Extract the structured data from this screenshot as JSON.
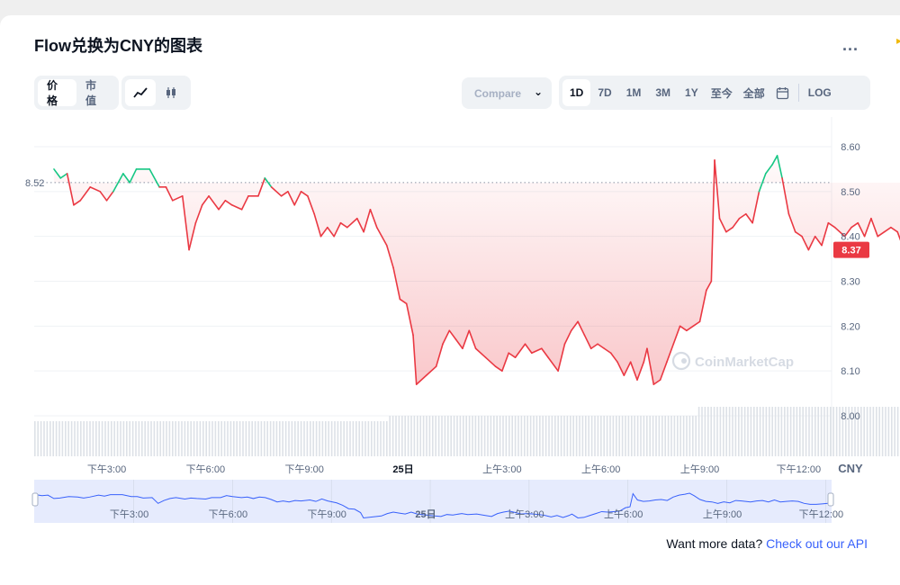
{
  "header": {
    "title": "Flow兑换为CNY的图表",
    "more_label": "...",
    "left_tabs": [
      "价格",
      "市值"
    ],
    "compare_label": "Compare",
    "ranges": [
      "1D",
      "7D",
      "1M",
      "3M",
      "1Y",
      "至今",
      "全部"
    ],
    "log_label": "LOG"
  },
  "footer": {
    "prefix": "Want more data?",
    "link": "Check out our API"
  },
  "watermark": "CoinMarketCap",
  "colors": {
    "up": "#16c784",
    "down": "#ea3943",
    "accent": "#3861fb",
    "nav_fill": "#e6ebfd"
  },
  "chart_data": {
    "type": "line",
    "y_axis_unit": "CNY",
    "ylim": [
      7.9,
      8.62
    ],
    "y_ticks": [
      8.0,
      8.1,
      8.2,
      8.3,
      8.4,
      8.5,
      8.6
    ],
    "y_tick_labels": [
      "8.00",
      "8.10",
      "8.20",
      "8.30",
      "8.40",
      "8.50",
      "8.60"
    ],
    "x_range_hours": [
      12.8,
      37.0
    ],
    "x_ticks": [
      {
        "h": 15,
        "label": "下午3:00"
      },
      {
        "h": 18,
        "label": "下午6:00"
      },
      {
        "h": 21,
        "label": "下午9:00"
      },
      {
        "h": 24,
        "label": "25日"
      },
      {
        "h": 27,
        "label": "上午3:00"
      },
      {
        "h": 30,
        "label": "上午6:00"
      },
      {
        "h": 33,
        "label": "上午9:00"
      },
      {
        "h": 36,
        "label": "下午12:00"
      }
    ],
    "reference_price": 8.52,
    "reference_label": "8.52",
    "last_price": 8.37,
    "last_label": "8.37",
    "series": [
      {
        "values": [
          [
            13.4,
            8.55
          ],
          [
            13.6,
            8.53
          ],
          [
            13.8,
            8.54
          ],
          [
            14.0,
            8.47
          ],
          [
            14.2,
            8.48
          ],
          [
            14.5,
            8.51
          ],
          [
            14.8,
            8.5
          ],
          [
            15.0,
            8.48
          ],
          [
            15.2,
            8.5
          ],
          [
            15.5,
            8.54
          ],
          [
            15.7,
            8.52
          ],
          [
            15.9,
            8.55
          ],
          [
            16.3,
            8.55
          ],
          [
            16.6,
            8.51
          ],
          [
            16.8,
            8.51
          ],
          [
            17.0,
            8.48
          ],
          [
            17.3,
            8.49
          ],
          [
            17.5,
            8.37
          ],
          [
            17.7,
            8.43
          ],
          [
            17.9,
            8.47
          ],
          [
            18.1,
            8.49
          ],
          [
            18.4,
            8.46
          ],
          [
            18.6,
            8.48
          ],
          [
            18.8,
            8.47
          ],
          [
            19.1,
            8.46
          ],
          [
            19.3,
            8.49
          ],
          [
            19.6,
            8.49
          ],
          [
            19.8,
            8.53
          ],
          [
            20.0,
            8.51
          ],
          [
            20.3,
            8.49
          ],
          [
            20.5,
            8.5
          ],
          [
            20.7,
            8.47
          ],
          [
            20.9,
            8.5
          ],
          [
            21.1,
            8.49
          ],
          [
            21.3,
            8.45
          ],
          [
            21.5,
            8.4
          ],
          [
            21.7,
            8.42
          ],
          [
            21.9,
            8.4
          ],
          [
            22.1,
            8.43
          ],
          [
            22.3,
            8.42
          ],
          [
            22.6,
            8.44
          ],
          [
            22.8,
            8.41
          ],
          [
            23.0,
            8.46
          ],
          [
            23.2,
            8.42
          ],
          [
            23.5,
            8.38
          ],
          [
            23.7,
            8.33
          ],
          [
            23.9,
            8.26
          ],
          [
            24.1,
            8.25
          ],
          [
            24.3,
            8.18
          ],
          [
            24.4,
            8.07
          ],
          [
            24.7,
            8.09
          ],
          [
            25.0,
            8.11
          ],
          [
            25.2,
            8.16
          ],
          [
            25.4,
            8.19
          ],
          [
            25.6,
            8.17
          ],
          [
            25.8,
            8.15
          ],
          [
            26.0,
            8.19
          ],
          [
            26.2,
            8.15
          ],
          [
            26.5,
            8.13
          ],
          [
            26.8,
            8.11
          ],
          [
            27.0,
            8.1
          ],
          [
            27.2,
            8.14
          ],
          [
            27.4,
            8.13
          ],
          [
            27.7,
            8.16
          ],
          [
            27.9,
            8.14
          ],
          [
            28.2,
            8.15
          ],
          [
            28.4,
            8.13
          ],
          [
            28.7,
            8.1
          ],
          [
            28.9,
            8.16
          ],
          [
            29.1,
            8.19
          ],
          [
            29.3,
            8.21
          ],
          [
            29.5,
            8.18
          ],
          [
            29.7,
            8.15
          ],
          [
            29.9,
            8.16
          ],
          [
            30.1,
            8.15
          ],
          [
            30.3,
            8.14
          ],
          [
            30.5,
            8.12
          ],
          [
            30.7,
            8.09
          ],
          [
            30.9,
            8.12
          ],
          [
            31.1,
            8.08
          ],
          [
            31.3,
            8.12
          ],
          [
            31.4,
            8.15
          ],
          [
            31.6,
            8.07
          ],
          [
            31.8,
            8.08
          ],
          [
            32.0,
            8.12
          ],
          [
            32.2,
            8.16
          ],
          [
            32.4,
            8.2
          ],
          [
            32.6,
            8.19
          ],
          [
            32.8,
            8.2
          ],
          [
            33.0,
            8.21
          ],
          [
            33.2,
            8.28
          ],
          [
            33.35,
            8.3
          ],
          [
            33.45,
            8.57
          ],
          [
            33.6,
            8.44
          ],
          [
            33.8,
            8.41
          ],
          [
            34.0,
            8.42
          ],
          [
            34.2,
            8.44
          ],
          [
            34.4,
            8.45
          ],
          [
            34.6,
            8.43
          ],
          [
            34.8,
            8.5
          ],
          [
            35.0,
            8.54
          ],
          [
            35.2,
            8.56
          ],
          [
            35.35,
            8.58
          ],
          [
            35.5,
            8.53
          ],
          [
            35.7,
            8.45
          ],
          [
            35.9,
            8.41
          ],
          [
            36.1,
            8.4
          ],
          [
            36.3,
            8.37
          ],
          [
            36.5,
            8.4
          ],
          [
            36.7,
            8.38
          ],
          [
            36.9,
            8.43
          ],
          [
            37.1,
            8.42
          ],
          [
            37.4,
            8.4
          ],
          [
            37.6,
            8.42
          ],
          [
            37.8,
            8.43
          ],
          [
            38.0,
            8.4
          ],
          [
            38.2,
            8.44
          ],
          [
            38.4,
            8.4
          ],
          [
            38.6,
            8.41
          ],
          [
            38.8,
            8.42
          ],
          [
            39.0,
            8.41
          ],
          [
            39.2,
            8.37
          ],
          [
            39.4,
            8.35
          ],
          [
            39.6,
            8.35
          ],
          [
            39.8,
            8.36
          ],
          [
            40.0,
            8.37
          ]
        ]
      }
    ]
  }
}
